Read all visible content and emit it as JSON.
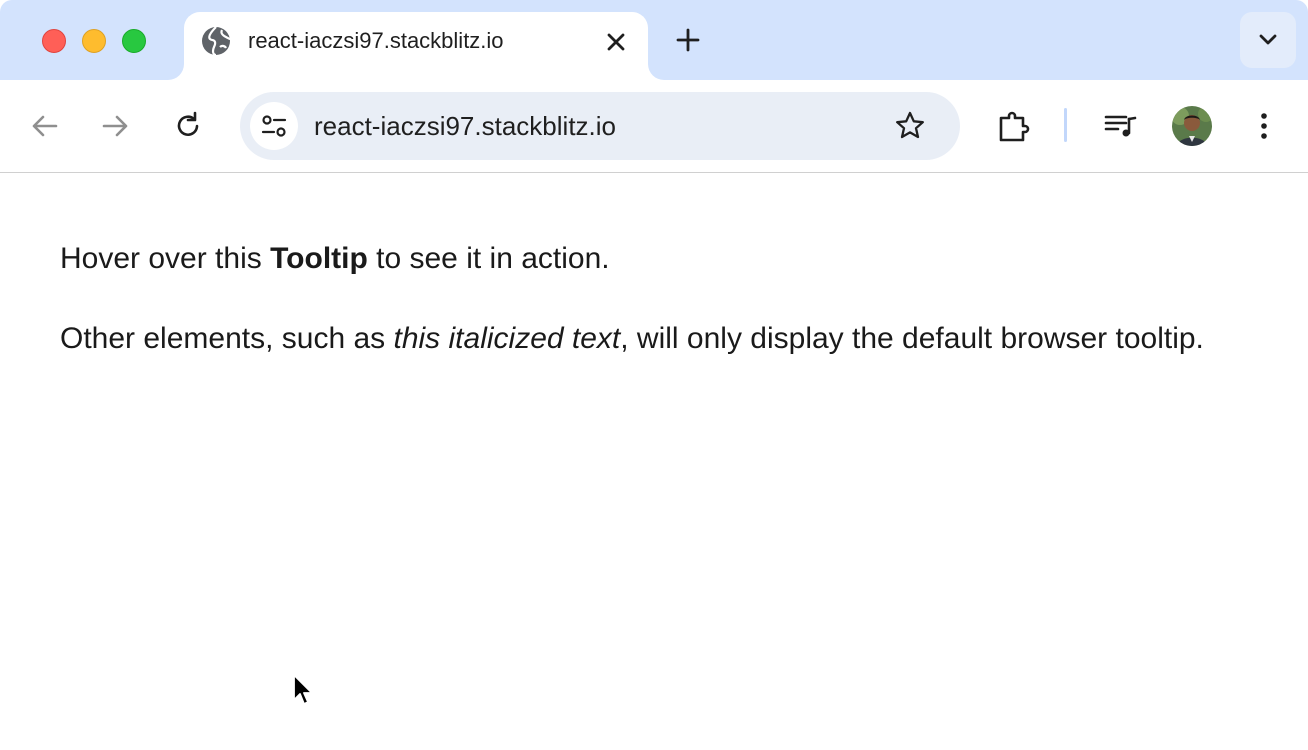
{
  "browser": {
    "tab": {
      "title": "react-iaczsi97.stackblitz.io",
      "favicon": "globe-icon",
      "close_icon": "close-icon"
    },
    "new_tab_icon": "plus-icon",
    "tab_search_icon": "chevron-down-icon",
    "toolbar": {
      "back_icon": "arrow-left-icon",
      "forward_icon": "arrow-right-icon",
      "reload_icon": "reload-icon",
      "site_info_icon": "tune-icon",
      "url": "react-iaczsi97.stackblitz.io",
      "bookmark_icon": "star-icon",
      "extensions_icon": "puzzle-icon",
      "media_icon": "playlist-icon",
      "menu_icon": "kebab-menu-icon"
    },
    "colors": {
      "tabstrip_bg": "#d3e3fd",
      "omnibox_bg": "#e9eef6",
      "traffic_red": "#ff5f57",
      "traffic_yellow": "#febc2e",
      "traffic_green": "#28c840"
    }
  },
  "page": {
    "paragraph1": {
      "before": "Hover over this ",
      "bold": "Tooltip",
      "after": " to see it in action."
    },
    "paragraph2": {
      "before": "Other elements, such as ",
      "italic": "this italicized text",
      "after": ", will only display the default browser tooltip."
    }
  }
}
